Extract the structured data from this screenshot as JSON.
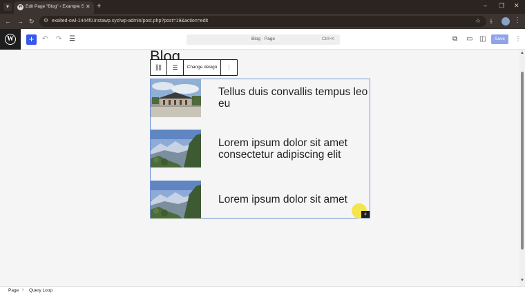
{
  "browser": {
    "tab_title": "Edit Page \"Blog\" ‹ Example Site",
    "new_tab": "+",
    "url": "exalted-owl-1444f0.instawp.xyz/wp-admin/post.php?post=19&action=edit"
  },
  "editor": {
    "inserter": "+",
    "document_title": "Blog · Page",
    "shortcut": "Ctrl+K",
    "save_label": "Save"
  },
  "canvas": {
    "page_heading": "Blog"
  },
  "block_toolbar": {
    "change_design": "Change design",
    "options": "⋮"
  },
  "query_loop": {
    "posts": [
      {
        "title": "Tellus duis convallis tempus leo eu",
        "thumbnail": "palace-building-image"
      },
      {
        "title": "Lorem ipsum dolor sit amet consectetur adipiscing elit",
        "thumbnail": "mountain-landscape-image"
      },
      {
        "title": "Lorem ipsum dolor sit amet",
        "thumbnail": "mountain-landscape-image"
      }
    ]
  },
  "footer": {
    "breadcrumb": [
      "Page",
      "Query Loop"
    ]
  },
  "colors": {
    "accent": "#3858e9",
    "selection_border": "#6b8fd6",
    "browser_chrome": "#2b2421"
  }
}
